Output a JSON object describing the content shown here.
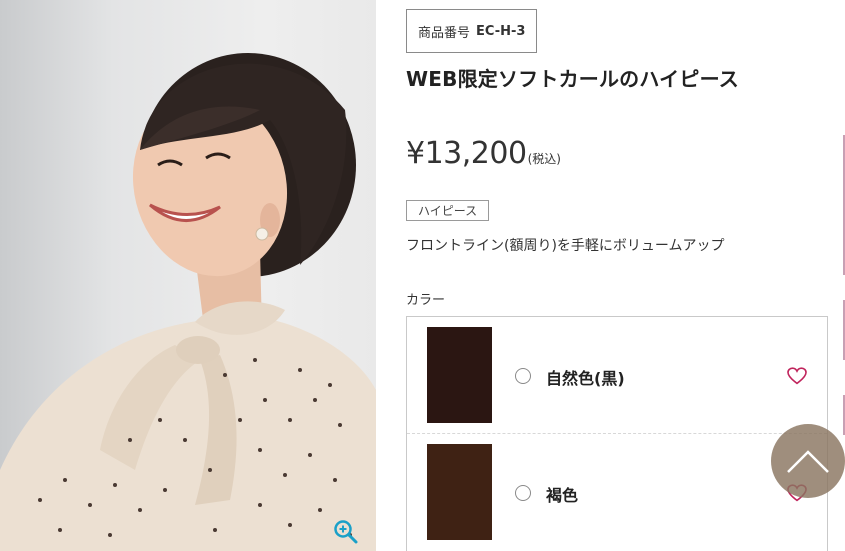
{
  "product": {
    "code_label": "商品番号",
    "code_value": "EC-H-3",
    "title": "WEB限定ソフトカールのハイピース",
    "price": "¥13,200",
    "tax_note": "(税込)",
    "category_tag": "ハイピース",
    "description": "フロントライン(額周り)を手軽にボリュームアップ"
  },
  "colors": {
    "label": "カラー",
    "options": [
      {
        "name": "自然色(黒)",
        "swatch": "#2b1612",
        "selected": false,
        "favorite_icon": "heart-outline-icon"
      },
      {
        "name": "褐色",
        "swatch": "#3f2214",
        "selected": false,
        "favorite_icon": "heart-outline-icon"
      }
    ]
  },
  "icons": {
    "zoom": "zoom-in-icon",
    "scroll_top": "chevron-up-icon"
  },
  "theme": {
    "accent": "#c0245c",
    "zoom_icon": "#1aa0c8"
  }
}
